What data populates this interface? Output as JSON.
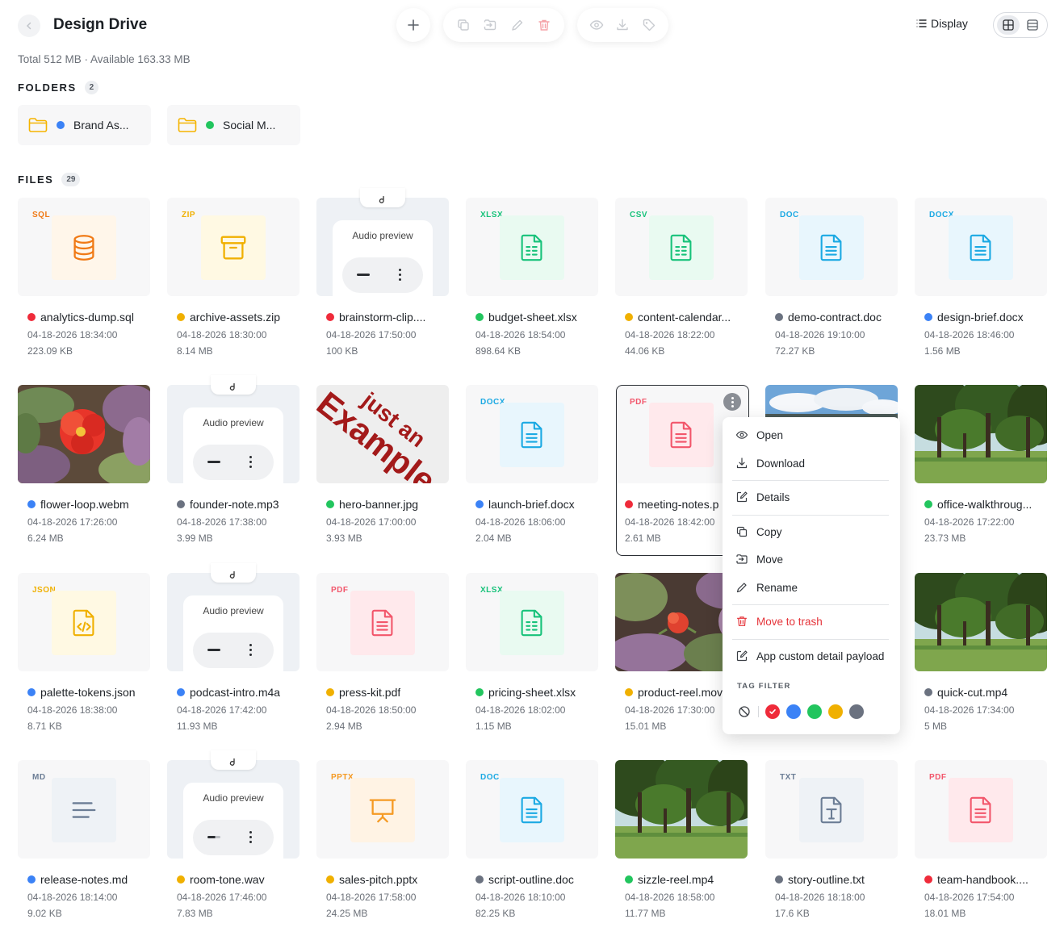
{
  "header": {
    "title": "Design Drive",
    "storage": "Total 512 MB · Available 163.33 MB",
    "display_label": "Display"
  },
  "folders_section": {
    "label": "FOLDERS",
    "count": "2"
  },
  "folders": [
    {
      "name": "Brand As...",
      "tag_color": "#3b82f6"
    },
    {
      "name": "Social M...",
      "tag_color": "#22c55e"
    }
  ],
  "files_section": {
    "label": "FILES",
    "count": "29"
  },
  "files": [
    {
      "name": "analytics-dump.sql",
      "date": "04-18-2026 18:34:00",
      "size": "223.09 KB",
      "tag_color": "#ef2b3a",
      "ext": "SQL",
      "kind": "database-icon"
    },
    {
      "name": "archive-assets.zip",
      "date": "04-18-2026 18:30:00",
      "size": "8.14 MB",
      "tag_color": "#f0b000",
      "ext": "ZIP",
      "kind": "archive-icon"
    },
    {
      "name": "brainstorm-clip....",
      "date": "04-18-2026 17:50:00",
      "size": "100 KB",
      "tag_color": "#ef2b3a",
      "ext": "",
      "kind": "audio-preview"
    },
    {
      "name": "budget-sheet.xlsx",
      "date": "04-18-2026 18:54:00",
      "size": "898.64 KB",
      "tag_color": "#22c55e",
      "ext": "XLSX",
      "kind": "spreadsheet-icon"
    },
    {
      "name": "content-calendar...",
      "date": "04-18-2026 18:22:00",
      "size": "44.06 KB",
      "tag_color": "#f0b000",
      "ext": "CSV",
      "kind": "spreadsheet-icon"
    },
    {
      "name": "demo-contract.doc",
      "date": "04-18-2026 19:10:00",
      "size": "72.27 KB",
      "tag_color": "#6b7280",
      "ext": "DOC",
      "kind": "document-icon"
    },
    {
      "name": "design-brief.docx",
      "date": "04-18-2026 18:46:00",
      "size": "1.56 MB",
      "tag_color": "#3b82f6",
      "ext": "DOCX",
      "kind": "document-icon"
    },
    {
      "name": "flower-loop.webm",
      "date": "04-18-2026 17:26:00",
      "size": "6.24 MB",
      "tag_color": "#3b82f6",
      "ext": "",
      "kind": "photo-flower"
    },
    {
      "name": "founder-note.mp3",
      "date": "04-18-2026 17:38:00",
      "size": "3.99 MB",
      "tag_color": "#6b7280",
      "ext": "",
      "kind": "audio-preview"
    },
    {
      "name": "hero-banner.jpg",
      "date": "04-18-2026 17:00:00",
      "size": "3.93 MB",
      "tag_color": "#22c55e",
      "ext": "",
      "kind": "photo-example"
    },
    {
      "name": "launch-brief.docx",
      "date": "04-18-2026 18:06:00",
      "size": "2.04 MB",
      "tag_color": "#3b82f6",
      "ext": "DOCX",
      "kind": "document-icon"
    },
    {
      "name": "meeting-notes.p",
      "date": "04-18-2026 18:42:00",
      "size": "2.61 MB",
      "tag_color": "#ef2b3a",
      "ext": "PDF",
      "kind": "pdf-icon"
    },
    {
      "name": "",
      "date": "",
      "size": "",
      "tag_color": "",
      "ext": "",
      "kind": "photo-sky"
    },
    {
      "name": "office-walkthroug...",
      "date": "04-18-2026 17:22:00",
      "size": "23.73 MB",
      "tag_color": "#22c55e",
      "ext": "",
      "kind": "photo-park"
    },
    {
      "name": "palette-tokens.json",
      "date": "04-18-2026 18:38:00",
      "size": "8.71 KB",
      "tag_color": "#3b82f6",
      "ext": "JSON",
      "kind": "code-icon"
    },
    {
      "name": "podcast-intro.m4a",
      "date": "04-18-2026 17:42:00",
      "size": "11.93 MB",
      "tag_color": "#3b82f6",
      "ext": "",
      "kind": "audio-preview"
    },
    {
      "name": "press-kit.pdf",
      "date": "04-18-2026 18:50:00",
      "size": "2.94 MB",
      "tag_color": "#f0b000",
      "ext": "PDF",
      "kind": "pdf-icon"
    },
    {
      "name": "pricing-sheet.xlsx",
      "date": "04-18-2026 18:02:00",
      "size": "1.15 MB",
      "tag_color": "#22c55e",
      "ext": "XLSX",
      "kind": "spreadsheet-icon"
    },
    {
      "name": "product-reel.mov",
      "date": "04-18-2026 17:30:00",
      "size": "15.01 MB",
      "tag_color": "#f0b000",
      "ext": "",
      "kind": "photo-bud"
    },
    {
      "name": "",
      "date": "",
      "size": "",
      "tag_color": "",
      "ext": "",
      "kind": "hidden"
    },
    {
      "name": "quick-cut.mp4",
      "date": "04-18-2026 17:34:00",
      "size": "5 MB",
      "tag_color": "#6b7280",
      "ext": "",
      "kind": "photo-park"
    },
    {
      "name": "release-notes.md",
      "date": "04-18-2026 18:14:00",
      "size": "9.02 KB",
      "tag_color": "#3b82f6",
      "ext": "MD",
      "kind": "text-lines-icon"
    },
    {
      "name": "room-tone.wav",
      "date": "04-18-2026 17:46:00",
      "size": "7.83 MB",
      "tag_color": "#f0b000",
      "ext": "",
      "kind": "audio-preview"
    },
    {
      "name": "sales-pitch.pptx",
      "date": "04-18-2026 17:58:00",
      "size": "24.25 MB",
      "tag_color": "#f0b000",
      "ext": "PPTX",
      "kind": "presentation-icon"
    },
    {
      "name": "script-outline.doc",
      "date": "04-18-2026 18:10:00",
      "size": "82.25 KB",
      "tag_color": "#6b7280",
      "ext": "DOC",
      "kind": "document-icon"
    },
    {
      "name": "sizzle-reel.mp4",
      "date": "04-18-2026 18:58:00",
      "size": "11.77 MB",
      "tag_color": "#22c55e",
      "ext": "",
      "kind": "photo-park"
    },
    {
      "name": "story-outline.txt",
      "date": "04-18-2026 18:18:00",
      "size": "17.6 KB",
      "tag_color": "#6b7280",
      "ext": "TXT",
      "kind": "txt-icon"
    },
    {
      "name": "team-handbook....",
      "date": "04-18-2026 17:54:00",
      "size": "18.01 MB",
      "tag_color": "#ef2b3a",
      "ext": "PDF",
      "kind": "pdf-icon"
    }
  ],
  "audio_preview_label": "Audio preview",
  "example_image_text": "just an Example",
  "context_menu": {
    "items": [
      {
        "label": "Open",
        "icon": "eye-icon"
      },
      {
        "label": "Download",
        "icon": "download-icon"
      },
      {
        "label": "Details",
        "icon": "edit-square-icon"
      },
      {
        "label": "Copy",
        "icon": "copy-icon"
      },
      {
        "label": "Move",
        "icon": "move-icon"
      },
      {
        "label": "Rename",
        "icon": "pencil-icon"
      },
      {
        "label": "Move to trash",
        "icon": "trash-icon"
      },
      {
        "label": "App custom detail payload",
        "icon": "edit-square-icon"
      }
    ],
    "tag_filter_label": "TAG FILTER",
    "tag_colors": [
      "#ef2b3a",
      "#3b82f6",
      "#22c55e",
      "#f0b000",
      "#6b7280"
    ]
  },
  "colors": {
    "accent_danger": "#e5343a",
    "sql": "#f07a16",
    "zip": "#f0b000",
    "xlsx": "#17c27a",
    "doc": "#1ba9e3",
    "pdf": "#f2566b",
    "json": "#f0b000",
    "pptx": "#f59a23",
    "md": "#6b7d95",
    "txt": "#6b7d95"
  }
}
